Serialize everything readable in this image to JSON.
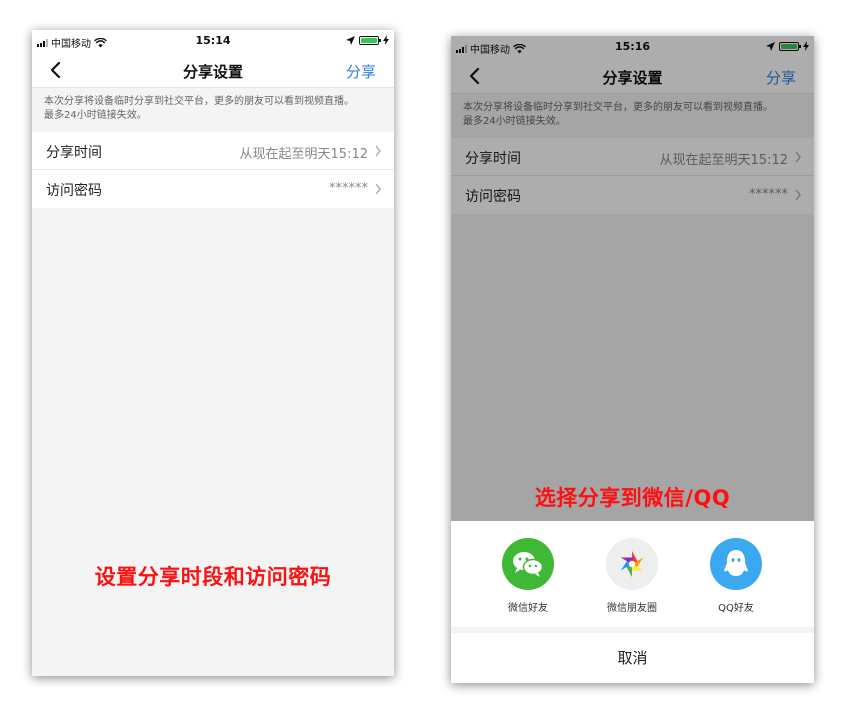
{
  "left_screen": {
    "status": {
      "carrier": "中国移动",
      "time": "15:14"
    },
    "nav": {
      "title": "分享设置",
      "action": "分享"
    },
    "notice": {
      "line1": "本次分享将设备临时分享到社交平台，更多的朋友可以看到视频直播。",
      "line2": "最多24小时链接失效。"
    },
    "rows": [
      {
        "label": "分享时间",
        "value": "从现在起至明天15:12"
      },
      {
        "label": "访问密码",
        "value": "******"
      }
    ],
    "caption": "设置分享时段和访问密码"
  },
  "right_screen": {
    "status": {
      "carrier": "中国移动",
      "time": "15:16"
    },
    "nav": {
      "title": "分享设置",
      "action": "分享"
    },
    "notice": {
      "line1": "本次分享将设备临时分享到社交平台，更多的朋友可以看到视频直播。",
      "line2": "最多24小时链接失效。"
    },
    "rows": [
      {
        "label": "分享时间",
        "value": "从现在起至明天15:12"
      },
      {
        "label": "访问密码",
        "value": "******"
      }
    ],
    "caption": "选择分享到微信/QQ",
    "share_sheet": {
      "targets": [
        {
          "label": "微信好友",
          "icon": "wechat-icon"
        },
        {
          "label": "微信朋友圈",
          "icon": "wechat-moments-icon"
        },
        {
          "label": "QQ好友",
          "icon": "qq-icon"
        }
      ],
      "cancel": "取消"
    }
  },
  "colors": {
    "accent": "#2f7de1",
    "caption": "#ff1010",
    "wechat": "#3fb838",
    "qq": "#3aa9f2",
    "battery": "#34c759"
  }
}
